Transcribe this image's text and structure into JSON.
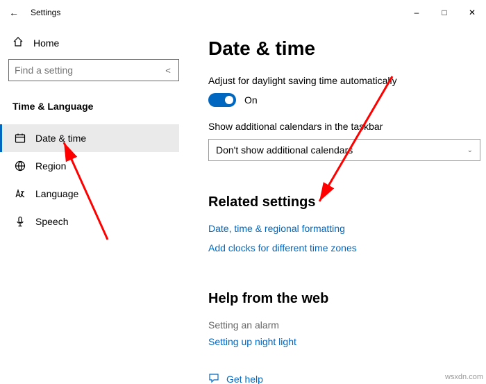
{
  "titlebar": {
    "title": "Settings"
  },
  "sidebar": {
    "home": "Home",
    "search_placeholder": "Find a setting",
    "category": "Time & Language",
    "items": [
      {
        "label": "Date & time"
      },
      {
        "label": "Region"
      },
      {
        "label": "Language"
      },
      {
        "label": "Speech"
      }
    ]
  },
  "main": {
    "title": "Date & time",
    "dst_label": "Adjust for daylight saving time automatically",
    "dst_state": "On",
    "cal_label": "Show additional calendars in the taskbar",
    "cal_value": "Don't show additional calendars",
    "related_heading": "Related settings",
    "related_links": [
      "Date, time & regional formatting",
      "Add clocks for different time zones"
    ],
    "web_heading": "Help from the web",
    "web_muted": "Setting an alarm",
    "web_link": "Setting up night light",
    "gethelp": "Get help"
  },
  "watermark": "wsxdn.com"
}
